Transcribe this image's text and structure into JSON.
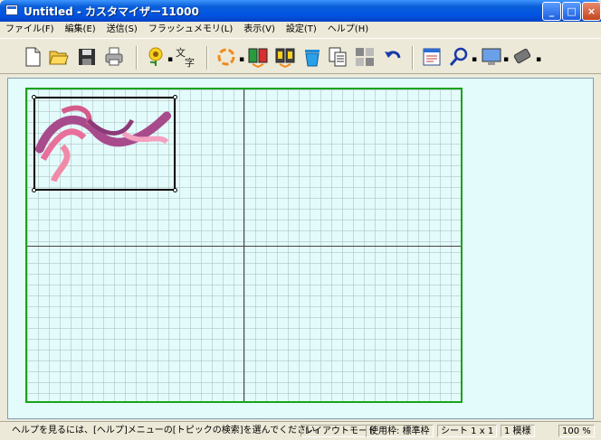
{
  "window": {
    "title": "Untitled - カスタマイザー11000"
  },
  "menu": [
    "ファイル(F)",
    "編集(E)",
    "送信(S)",
    "フラッシュメモリ(L)",
    "表示(V)",
    "設定(T)",
    "ヘルプ(H)"
  ],
  "toolbar": {
    "icons": [
      "new-file-icon",
      "open-folder-icon",
      "save-disk-icon",
      "print-icon",
      "embroidery-flower-icon",
      "text-icon",
      "rotate-icon",
      "color-sort-icon",
      "split-color-icon",
      "trash-icon",
      "copy-icon",
      "grid-layout-icon",
      "undo-icon",
      "properties-icon",
      "zoom-icon",
      "monitor-icon",
      "transfer-icon"
    ]
  },
  "statusbar": {
    "help": "ヘルプを見るには、[ヘルプ]メニューの[トピックの検索]を選んでください。",
    "mode": "レイアウトモード",
    "frame": "使用枠: 標準枠",
    "sheet": "シート 1 x 1",
    "pattern": "1 模様",
    "zoom": "100 %"
  }
}
